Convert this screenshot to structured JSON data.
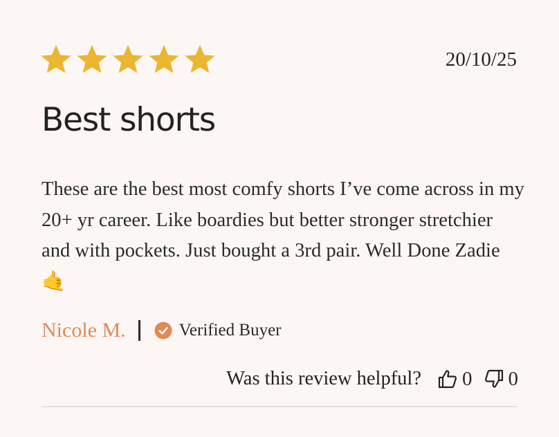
{
  "review": {
    "rating": 5,
    "max_rating": 5,
    "date": "20/10/25",
    "title": "Best shorts",
    "body": "These are the best most comfy shorts I’ve come across in my 20+ yr career. Like boardies but better stronger stretchier and with pockets. Just bought a 3rd pair. Well Done Zadie 🤙",
    "author": "Nicole M.",
    "verified_label": "Verified Buyer"
  },
  "helpful": {
    "question": "Was this review helpful?",
    "upvotes": "0",
    "downvotes": "0"
  },
  "colors": {
    "star": "#ebb630",
    "author": "#e08a55",
    "verified_badge": "#e08a55",
    "background": "#fcf7f5"
  },
  "icons": {
    "star": "star-icon",
    "verified": "check-circle-icon",
    "upvote": "thumbs-up-icon",
    "downvote": "thumbs-down-icon"
  }
}
